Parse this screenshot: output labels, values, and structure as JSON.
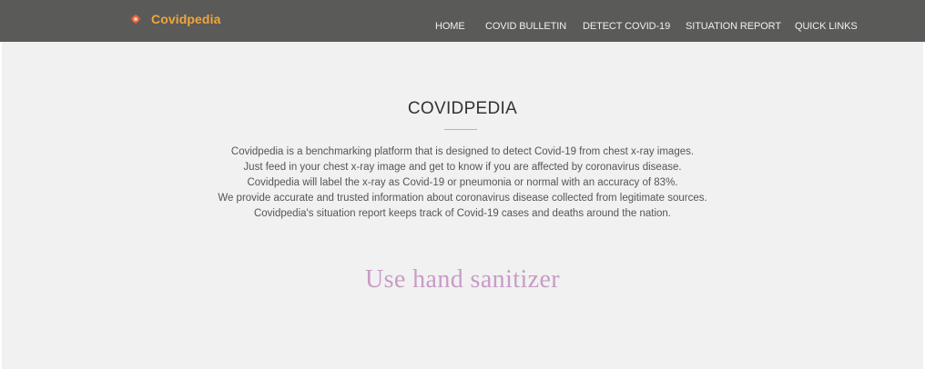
{
  "header": {
    "brand_name": "Covidpedia",
    "brand_icon": "virus-icon",
    "brand_color": "#f0a63a",
    "background_color": "#5a5a58",
    "nav": [
      {
        "label": "HOME"
      },
      {
        "label": "COVID BULLETIN"
      },
      {
        "label": "DETECT COVID-19"
      },
      {
        "label": "SITUATION REPORT"
      },
      {
        "label": "QUICK LINKS"
      }
    ]
  },
  "main": {
    "title": "COVIDPEDIA",
    "accent_color": "#f2a65a",
    "description_lines": [
      "Covidpedia is a benchmarking platform that is designed to detect Covid-19 from chest x-ray images.",
      "Just feed in your chest x-ray image and get to know if you are affected by coronavirus disease.",
      "Covidpedia will label the x-ray as Covid-19 or pneumonia or normal with an accuracy of 83%.",
      "We provide accurate and trusted information about coronavirus disease collected from legitimate sources.",
      "Covidpedia's situation report keeps track of Covid-19 cases and deaths around the nation."
    ],
    "tagline": "Use hand sanitizer",
    "tagline_color": "#c79cc6"
  }
}
